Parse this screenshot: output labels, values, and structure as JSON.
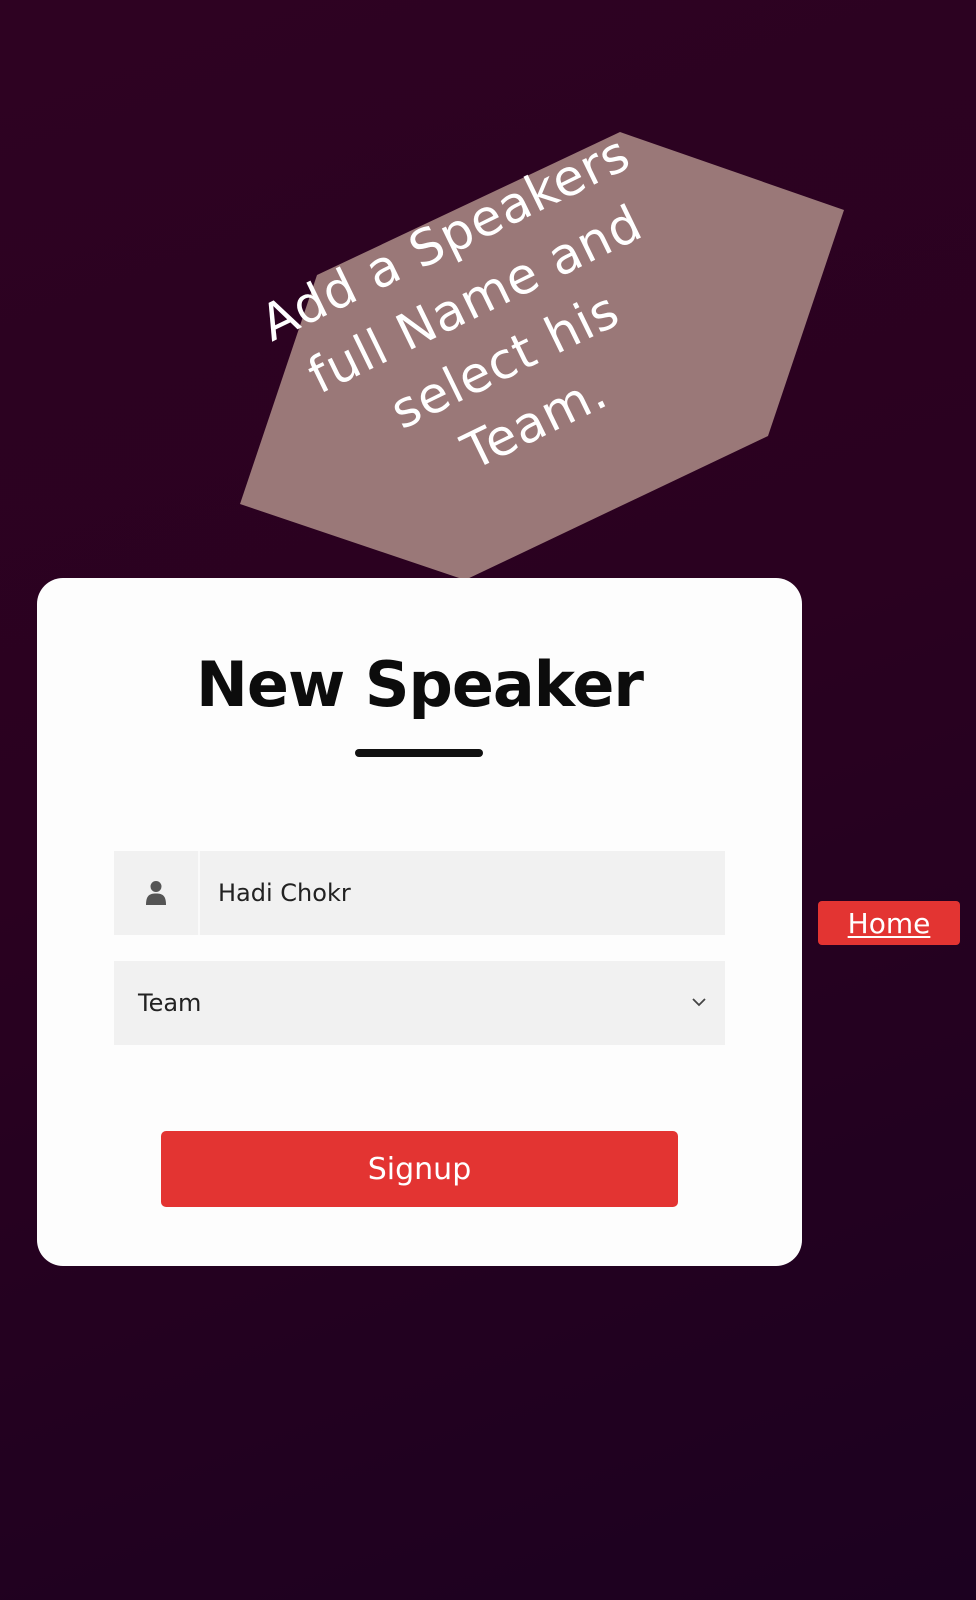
{
  "callout": {
    "line1": "Add a Speakers",
    "line2": "full Name and",
    "line3": "select his",
    "line4": "Team."
  },
  "form": {
    "title": "New Speaker",
    "name_value": "Hadi Chokr",
    "team_label": "Team",
    "submit_label": "Signup"
  },
  "nav": {
    "home_label": "Home"
  },
  "icons": {
    "name_icon": "user-icon",
    "select_icon": "chevron-down-icon"
  },
  "colors": {
    "accent": "#e33432",
    "callout_bg": "#9a7878",
    "background": "#2a0120"
  }
}
